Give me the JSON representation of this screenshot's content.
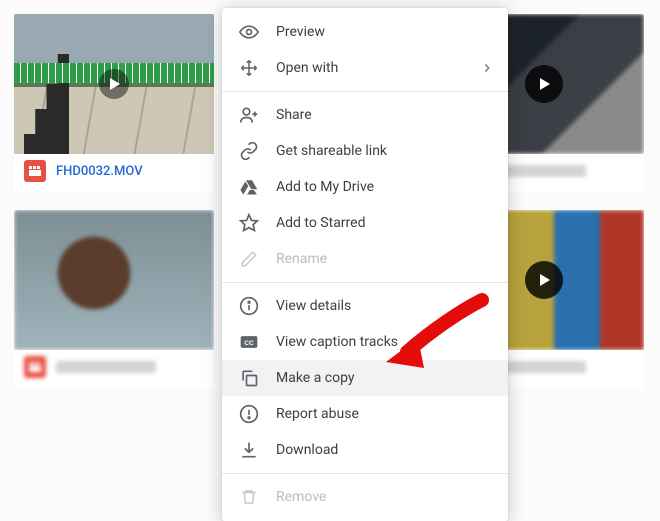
{
  "file": {
    "name": "FHD0032.MOV"
  },
  "menu": {
    "preview": "Preview",
    "open_with": "Open with",
    "share": "Share",
    "link": "Get shareable link",
    "add_drive": "Add to My Drive",
    "star": "Add to Starred",
    "rename": "Rename",
    "details": "View details",
    "captions": "View caption tracks",
    "copy": "Make a copy",
    "abuse": "Report abuse",
    "download": "Download",
    "remove": "Remove"
  }
}
